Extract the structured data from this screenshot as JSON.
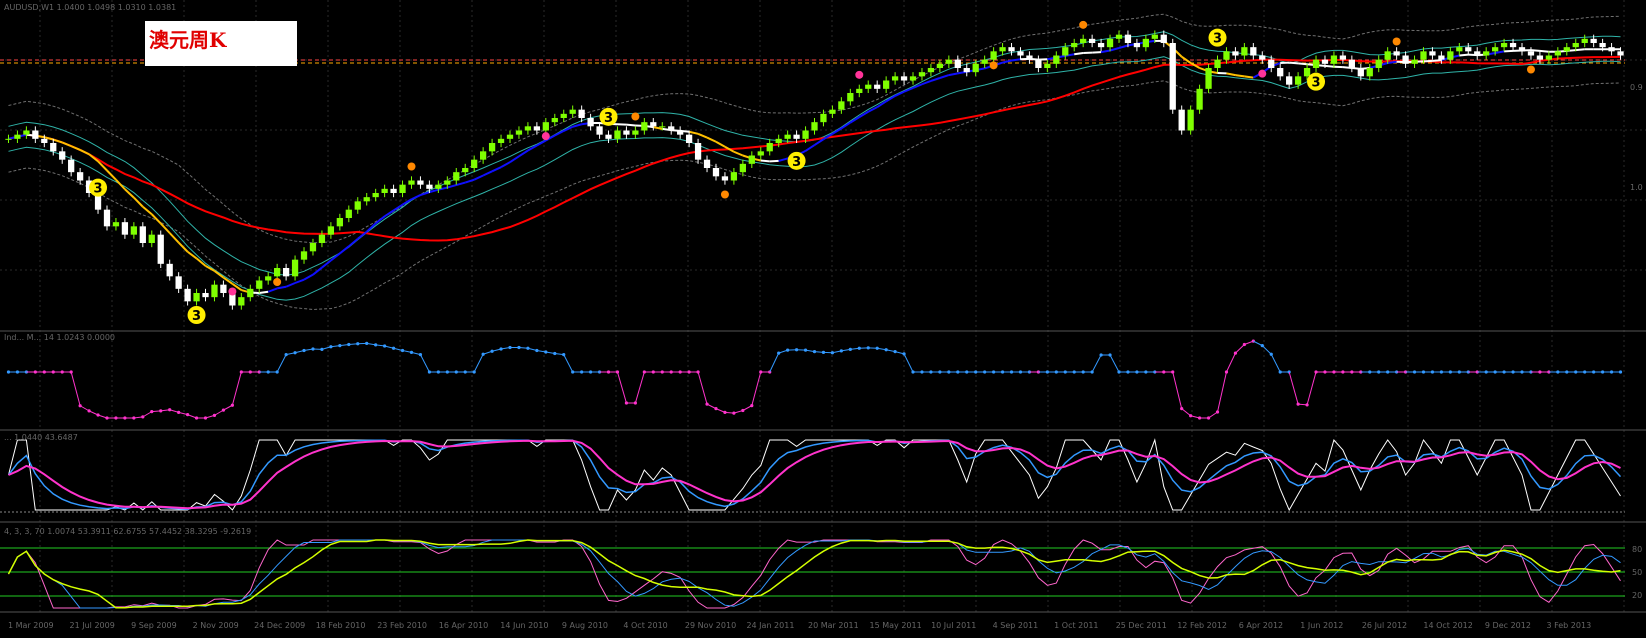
{
  "title": "澳元周K",
  "colors": {
    "bg": "#000000",
    "grid": "#2a2a2a",
    "bull": "#7fff00",
    "bear": "#ffffff",
    "ma_red": "#ff0000",
    "ma_blue": "#1010ff",
    "ma_yellow": "#ffc000",
    "ma_white": "#ffffff",
    "band": "#2fb3a8",
    "envelope": "#707070",
    "signal_blue": "#3399ff",
    "signal_magenta": "#ff33cc",
    "k_line": "#ffffff",
    "d_line": "#3399ff",
    "j_line": "#ff33cc",
    "osc_green": "#22cc22",
    "osc_yellow": "#d4ff00"
  },
  "panel_headers": [
    "AUDUSD,W1  1.0400  1.0498  1.0310  1.0381",
    "Ind... M... 14  1.0243  0.0000",
    "... 1.0440  43.6487",
    "4, 3, 3, 70  1.0074  53.3911  62.6755  57.4452  38.3295  -9.2619"
  ],
  "x_tick_labels": [
    "1 Mar 2009",
    "21 Jul 2009",
    "9 Sep 2009",
    "2 Nov 2009",
    "24 Dec 2009",
    "18 Feb 2010",
    "23 Feb 2010",
    "16 Apr 2010",
    "14 Jun 2010",
    "9 Aug 2010",
    "4 Oct 2010",
    "29 Nov 2010",
    "24 Jan 2011",
    "20 Mar 2011",
    "15 May 2011",
    "10 Jul 2011",
    "4 Sep 2011",
    "1 Oct 2011",
    "25 Dec 2011",
    "12 Feb 2012",
    "6 Apr 2012",
    "1 Jun 2012",
    "26 Jul 2012",
    "14 Oct 2012",
    "9 Dec 2012",
    "3 Feb 2013"
  ],
  "right_scale_labels": [
    "0.9",
    "1.0",
    "80",
    "50",
    "20"
  ],
  "chart_data": {
    "type": "candlestick",
    "title": "澳元周K",
    "symbol": "AUDUSD",
    "timeframe": "W1",
    "candle_count": 181,
    "approx_close": [
      1.03,
      1.04,
      1.05,
      1.03,
      1.02,
      1.0,
      0.98,
      0.95,
      0.93,
      0.9,
      0.86,
      0.82,
      0.83,
      0.8,
      0.82,
      0.78,
      0.8,
      0.73,
      0.7,
      0.67,
      0.64,
      0.66,
      0.65,
      0.68,
      0.66,
      0.63,
      0.65,
      0.67,
      0.69,
      0.7,
      0.72,
      0.7,
      0.74,
      0.76,
      0.78,
      0.8,
      0.82,
      0.84,
      0.86,
      0.88,
      0.89,
      0.9,
      0.91,
      0.9,
      0.92,
      0.93,
      0.92,
      0.91,
      0.92,
      0.93,
      0.95,
      0.96,
      0.98,
      1.0,
      1.02,
      1.03,
      1.04,
      1.05,
      1.06,
      1.05,
      1.07,
      1.08,
      1.09,
      1.1,
      1.08,
      1.06,
      1.04,
      1.03,
      1.05,
      1.04,
      1.05,
      1.07,
      1.06,
      1.06,
      1.05,
      1.04,
      1.02,
      0.98,
      0.96,
      0.94,
      0.93,
      0.95,
      0.97,
      0.99,
      1.0,
      1.02,
      1.03,
      1.04,
      1.03,
      1.05,
      1.07,
      1.09,
      1.1,
      1.12,
      1.14,
      1.15,
      1.16,
      1.15,
      1.17,
      1.18,
      1.17,
      1.18,
      1.19,
      1.2,
      1.21,
      1.22,
      1.2,
      1.19,
      1.21,
      1.22,
      1.24,
      1.25,
      1.24,
      1.23,
      1.22,
      1.2,
      1.21,
      1.23,
      1.25,
      1.26,
      1.27,
      1.26,
      1.25,
      1.27,
      1.28,
      1.26,
      1.25,
      1.27,
      1.28,
      1.26,
      1.1,
      1.05,
      1.1,
      1.15,
      1.2,
      1.22,
      1.24,
      1.23,
      1.25,
      1.23,
      1.22,
      1.2,
      1.18,
      1.16,
      1.18,
      1.2,
      1.22,
      1.21,
      1.23,
      1.22,
      1.2,
      1.18,
      1.2,
      1.22,
      1.24,
      1.23,
      1.21,
      1.22,
      1.24,
      1.23,
      1.22,
      1.24,
      1.25,
      1.24,
      1.23,
      1.24,
      1.25,
      1.26,
      1.25,
      1.24,
      1.23,
      1.22,
      1.23,
      1.24,
      1.25,
      1.26,
      1.27,
      1.26,
      1.25,
      1.24,
      1.23
    ],
    "overlays": [
      "red slow MA",
      "blue/yellow/white color-switching MA",
      "cyan bands",
      "grey envelope"
    ],
    "signal_badges": [
      "3",
      "3",
      "3",
      "3",
      "3",
      "3"
    ],
    "ylim": [
      0.6,
      1.32
    ]
  }
}
